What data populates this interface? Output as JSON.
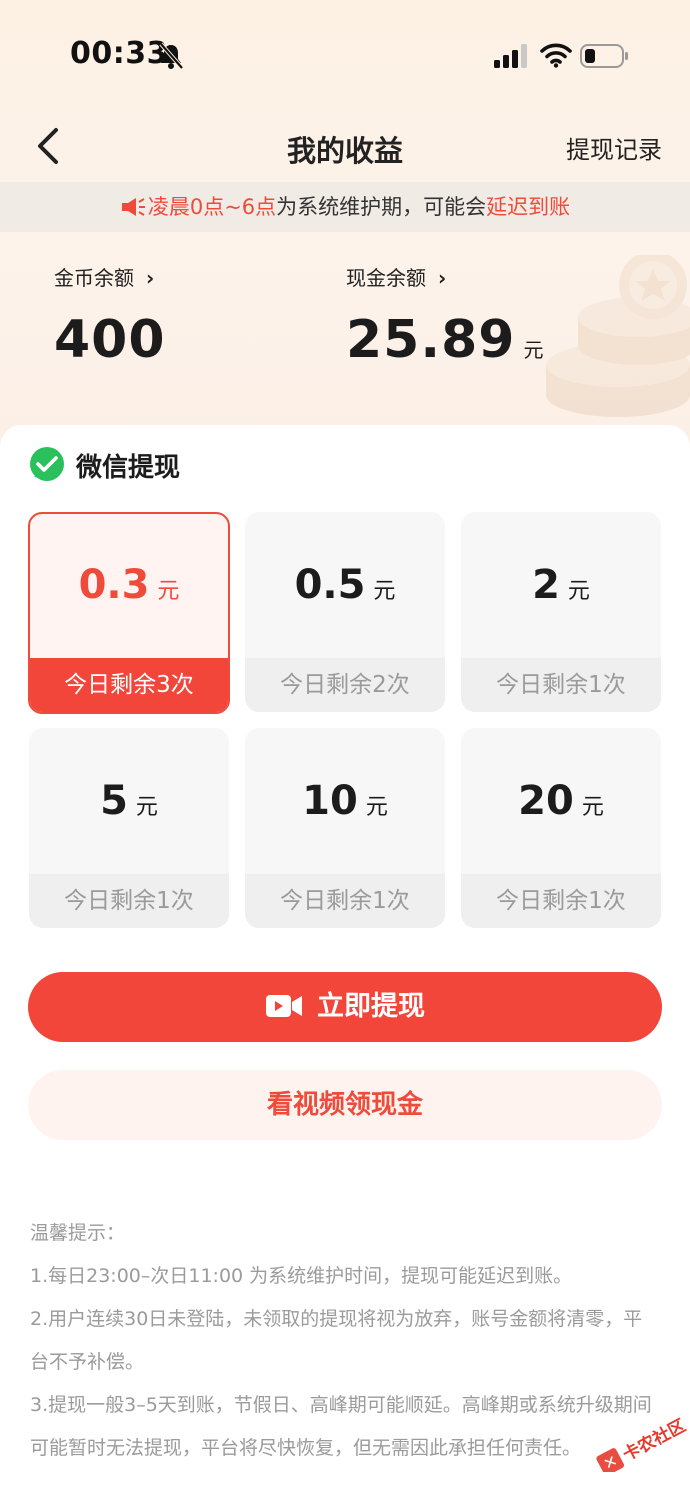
{
  "status_bar": {
    "time": "00:33"
  },
  "nav": {
    "title": "我的收益",
    "right_link": "提现记录"
  },
  "notice": {
    "part1": "凌晨0点~6点",
    "part2": "为系统维护期，可能会",
    "part3": "延迟到账"
  },
  "balances": {
    "coin_label": "金币余额",
    "coin_value": "400",
    "cash_label": "现金余额",
    "cash_value": "25.89",
    "cash_unit": "元"
  },
  "withdraw": {
    "title": "微信提现",
    "options": [
      {
        "amount": "0.3",
        "unit": "元",
        "remaining": "今日剩余3次",
        "selected": true
      },
      {
        "amount": "0.5",
        "unit": "元",
        "remaining": "今日剩余2次",
        "selected": false
      },
      {
        "amount": "2",
        "unit": "元",
        "remaining": "今日剩余1次",
        "selected": false
      },
      {
        "amount": "5",
        "unit": "元",
        "remaining": "今日剩余1次",
        "selected": false
      },
      {
        "amount": "10",
        "unit": "元",
        "remaining": "今日剩余1次",
        "selected": false
      },
      {
        "amount": "20",
        "unit": "元",
        "remaining": "今日剩余1次",
        "selected": false
      }
    ]
  },
  "buttons": {
    "withdraw_now": "立即提现",
    "watch_video": "看视频领现金"
  },
  "tips": {
    "title": "温馨提示：",
    "line1": "1.每日23:00–次日11:00 为系统维护时间，提现可能延迟到账。",
    "line2": "2.用户连续30日未登陆，未领取的提现将视为放弃，账号金额将清零，平台不予补偿。",
    "line3": "3.提现一般3–5天到账，节假日、高峰期可能顺延。高峰期或系统升级期间可能暂时无法提现，平台将尽快恢复，但无需因此承担任何责任。"
  },
  "watermark": {
    "text": "卡农社区"
  },
  "colors": {
    "accent": "#f2463a",
    "wechat_green": "#2ac15d"
  }
}
